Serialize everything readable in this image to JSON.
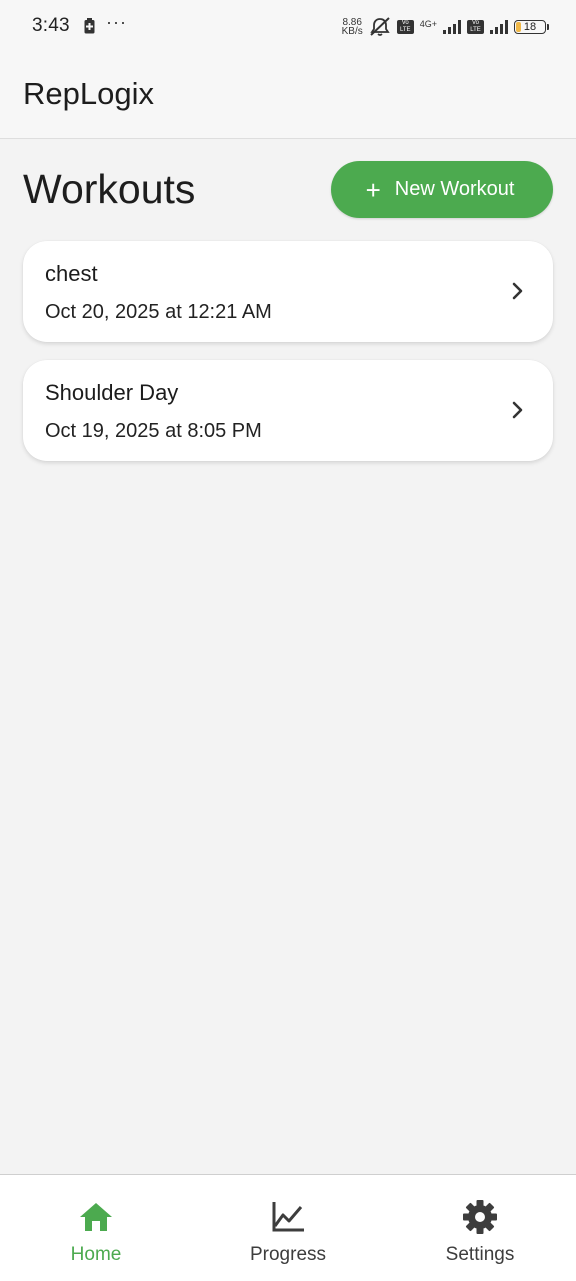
{
  "status_bar": {
    "time": "3:43",
    "dots": "···",
    "net_speed_value": "8.86",
    "net_speed_unit": "KB/s",
    "volte_top": "Vo",
    "volte_bottom": "LTE",
    "net_type": "4G+",
    "battery_level": "18"
  },
  "app_bar": {
    "title": "RepLogix"
  },
  "page": {
    "title": "Workouts",
    "new_workout_label": "New Workout"
  },
  "workouts": [
    {
      "name": "chest",
      "date": "Oct 20, 2025 at 12:21 AM"
    },
    {
      "name": "Shoulder Day",
      "date": "Oct 19, 2025 at 8:05 PM"
    }
  ],
  "bottom_nav": {
    "items": [
      {
        "label": "Home",
        "icon": "home-icon",
        "active": true
      },
      {
        "label": "Progress",
        "icon": "chart-line-icon",
        "active": false
      },
      {
        "label": "Settings",
        "icon": "gear-icon",
        "active": false
      }
    ]
  },
  "colors": {
    "accent": "#4caa4f",
    "background": "#f3f3f3",
    "card": "#ffffff",
    "text": "#1c1c1c",
    "nav_inactive": "#3d3d3d"
  }
}
